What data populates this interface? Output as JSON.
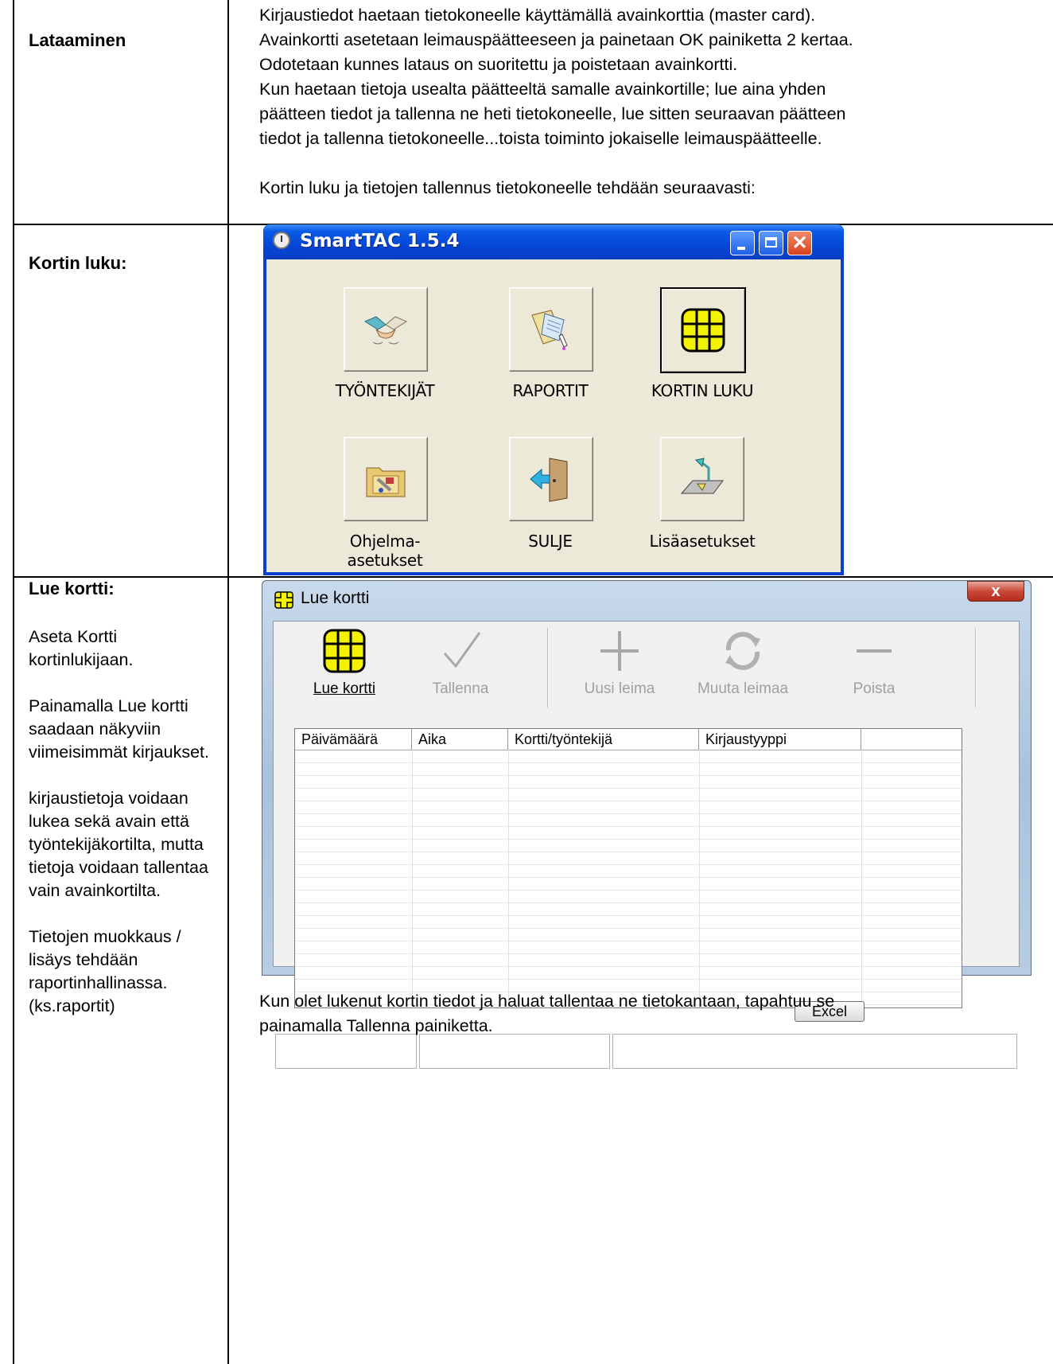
{
  "doc": {
    "rows": [
      {
        "label": "Lataaminen",
        "paragraphs": [
          "Kirjaustiedot haetaan tietokoneelle käyttämällä avainkorttia (master card).",
          "Avainkortti asetetaan leimauspäätteeseen ja painetaan OK painiketta 2 kertaa.",
          "Odotetaan kunnes lataus on suoritettu ja poistetaan avainkortti.",
          "Kun haetaan tietoja usealta päätteeltä samalle avainkortille; lue aina yhden",
          "päätteen tiedot ja tallenna ne heti tietokoneelle, lue sitten seuraavan päätteen",
          "tiedot ja tallenna tietokoneelle...toista toiminto jokaiselle leimauspäätteelle.",
          "",
          "Kortin luku ja tietojen tallennus tietokoneelle tehdään seuraavasti:"
        ]
      },
      {
        "label": "Kortin luku:"
      },
      {
        "label": "Lue kortti:",
        "side": [
          "Aseta Kortti kortinlukijaan.",
          "Painamalla Lue kortti saadaan näkyviin viimeisimmät kirjaukset.",
          "kirjaustietoja voidaan lukea sekä avain että työntekijäkortilta, mutta tietoja voidaan tallentaa vain avainkortilta.",
          "Tietojen muokkaus / lisäys tehdään raportinhallinassa. (ks.raportit)"
        ],
        "footer": [
          "Kun olet lukenut kortin tiedot ja haluat tallentaa ne tietokantaan, tapahtuu se",
          "painamalla Tallenna painiketta."
        ]
      }
    ]
  },
  "smarttac": {
    "title": "SmartTAC 1.5.4",
    "tiles": [
      {
        "label": "TYÖNTEKIJÄT",
        "icon": "handshake-icon"
      },
      {
        "label": "RAPORTIT",
        "icon": "report-folder-icon"
      },
      {
        "label": "KORTIN LUKU",
        "icon": "smartcard-chip-icon"
      },
      {
        "label": "Ohjelma-asetukset",
        "icon": "settings-folder-icon"
      },
      {
        "label": "SULJE",
        "icon": "exit-door-icon"
      },
      {
        "label": "Lisäasetukset",
        "icon": "desk-lamp-icon"
      }
    ]
  },
  "luekortti": {
    "title": "Lue kortti",
    "close": "x",
    "toolbar": [
      {
        "label": "Lue kortti",
        "enabled": true,
        "icon": "smartcard-chip-icon"
      },
      {
        "label": "Tallenna",
        "enabled": false,
        "icon": "checkmark-icon"
      },
      {
        "label": "Uusi leima",
        "enabled": false,
        "icon": "plus-icon"
      },
      {
        "label": "Muuta leimaa",
        "enabled": false,
        "icon": "refresh-icon"
      },
      {
        "label": "Poista",
        "enabled": false,
        "icon": "minus-icon"
      }
    ],
    "columns": [
      "Päivämäärä",
      "Aika",
      "Kortti/työntekijä",
      "Kirjaustyyppi",
      ""
    ],
    "excel_label": "Excel"
  },
  "colors": {
    "xp_blue": "#0546d6",
    "chip_yellow": "#f5f200",
    "disabled_gray": "#a0a0a0"
  }
}
